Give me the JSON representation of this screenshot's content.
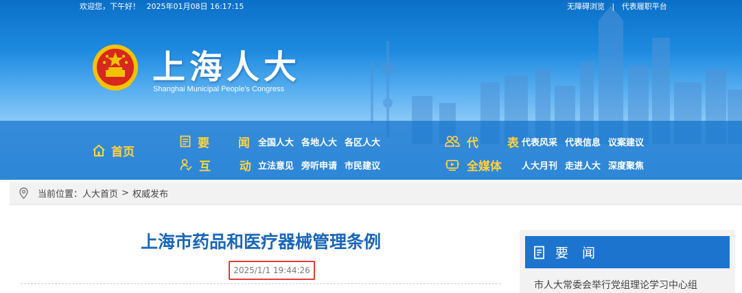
{
  "top_bar": {
    "greeting": "欢迎您，下午好！",
    "datetime": "2025年01月08日 16:17:15",
    "links": [
      "无障碍浏览",
      "代表履职平台"
    ],
    "separator": "|"
  },
  "logo": {
    "name_cn": "上海人大",
    "name_en": "Shanghai Municipal People's Congress"
  },
  "nav": {
    "home": "首页",
    "groups": [
      {
        "label": "要 闻",
        "icon": "document-icon",
        "links": [
          "全国人大",
          "各地人大",
          "各区人大"
        ]
      },
      {
        "label": "互 动",
        "icon": "interaction-icon",
        "links": [
          "立法意见",
          "旁听申请",
          "市民建议"
        ]
      },
      {
        "label": "代 表",
        "icon": "people-icon",
        "links": [
          "代表风采",
          "代表信息",
          "议案建议"
        ]
      },
      {
        "label": "全媒体",
        "icon": "media-icon",
        "links": [
          "人大月刊",
          "走进人大",
          "深度聚焦"
        ]
      }
    ]
  },
  "breadcrumb": {
    "prefix": "当前位置：",
    "items": [
      "人大首页",
      "权威发布"
    ],
    "separator": ">"
  },
  "article": {
    "title": "上海市药品和医疗器械管理条例",
    "date": "2025/1/1 19:44:26"
  },
  "sidebar": {
    "header": "要 闻",
    "items": [
      "市人大常委会举行党组理论学习中心组"
    ]
  },
  "colors": {
    "accent_yellow": "#ffd33d",
    "title_blue": "#1a66b8",
    "panel_blue": "#1d74cf",
    "highlight_red": "#e53935"
  }
}
